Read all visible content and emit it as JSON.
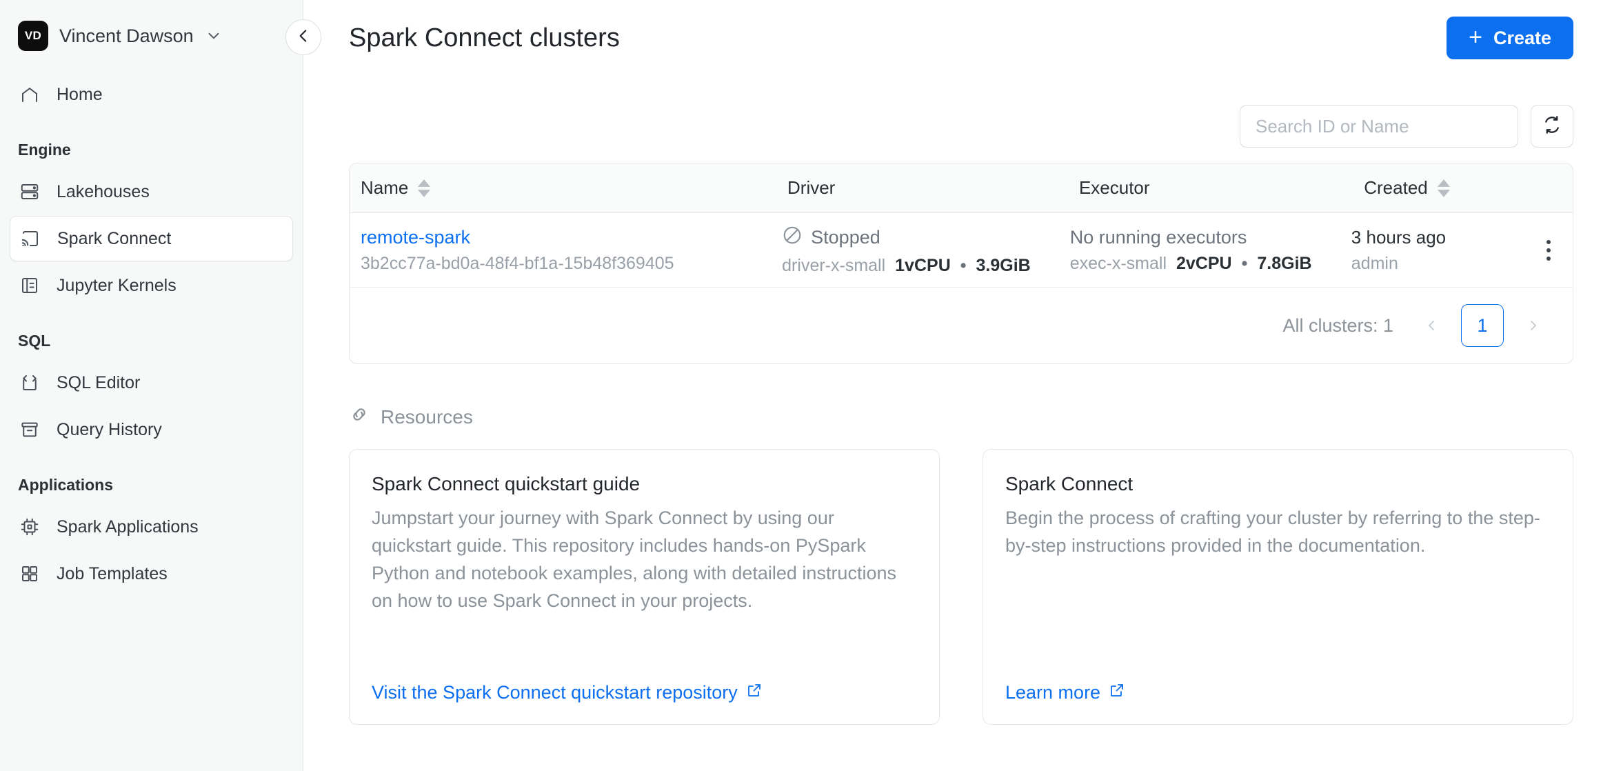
{
  "sidebar": {
    "account": {
      "initials": "VD",
      "name": "Vincent Dawson"
    },
    "home": {
      "label": "Home"
    },
    "groups": [
      {
        "title": "Engine",
        "items": [
          {
            "label": "Lakehouses",
            "icon": "database-icon",
            "active": false
          },
          {
            "label": "Spark Connect",
            "icon": "cast-icon",
            "active": true
          },
          {
            "label": "Jupyter Kernels",
            "icon": "notebook-icon",
            "active": false
          }
        ]
      },
      {
        "title": "SQL",
        "items": [
          {
            "label": "SQL Editor",
            "icon": "code-file-icon",
            "active": false
          },
          {
            "label": "Query History",
            "icon": "archive-icon",
            "active": false
          }
        ]
      },
      {
        "title": "Applications",
        "items": [
          {
            "label": "Spark Applications",
            "icon": "cpu-icon",
            "active": false
          },
          {
            "label": "Job Templates",
            "icon": "grid-icon",
            "active": false
          }
        ]
      }
    ]
  },
  "header": {
    "title": "Spark Connect clusters",
    "create_label": "Create",
    "create_color": "#0b6ff0"
  },
  "toolbar": {
    "search_placeholder": "Search ID or Name",
    "search_value": "",
    "refresh_label": "Refresh"
  },
  "table": {
    "columns": [
      {
        "label": "Name",
        "sortable": true
      },
      {
        "label": "Driver",
        "sortable": false
      },
      {
        "label": "Executor",
        "sortable": false
      },
      {
        "label": "Created",
        "sortable": true
      }
    ],
    "rows": [
      {
        "name": "remote-spark",
        "id": "3b2cc77a-bd0a-48f4-bf1a-15b48f369405",
        "driver_status": "Stopped",
        "driver_size": "driver-x-small",
        "driver_cpu": "1vCPU",
        "driver_sep": "•",
        "driver_mem": "3.9GiB",
        "executor_status": "No running executors",
        "executor_size": "exec-x-small",
        "executor_cpu": "2vCPU",
        "executor_sep": "•",
        "executor_mem": "7.8GiB",
        "created": "3 hours ago",
        "created_by": "admin"
      }
    ],
    "footer": {
      "count_label": "All clusters: 1",
      "prev_label": "‹",
      "page_label": "1",
      "next_label": "›"
    }
  },
  "resources": {
    "section_label": "Resources",
    "cards": [
      {
        "title": "Spark Connect quickstart guide",
        "body": "Jumpstart your journey with Spark Connect by using our quickstart guide. This repository includes hands-on PySpark Python and notebook examples, along with detailed instructions on how to use Spark Connect in your projects.",
        "link": "Visit the Spark Connect quickstart repository"
      },
      {
        "title": "Spark Connect",
        "body": "Begin the process of crafting your cluster by referring to the step-by-step instructions provided in the documentation.",
        "link": "Learn more"
      }
    ]
  }
}
